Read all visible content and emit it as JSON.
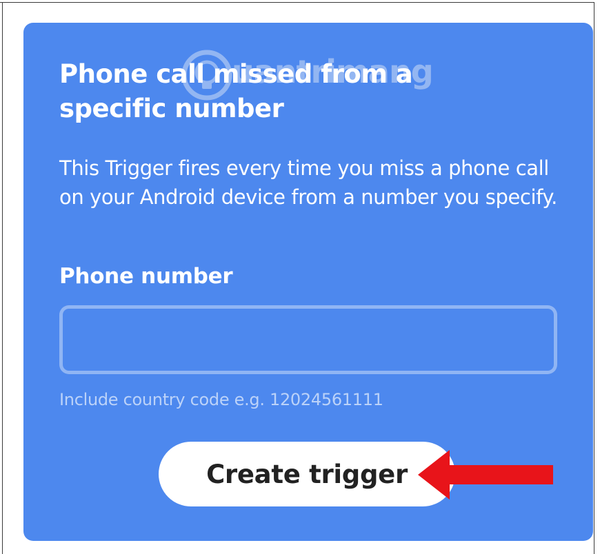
{
  "card": {
    "title": "Phone call missed from a specific number",
    "description": "This Trigger fires every time you miss a phone call on your Android device from a number you specify.",
    "field_label": "Phone number",
    "phone_input": {
      "value": "",
      "placeholder": ""
    },
    "hint": "Include country code e.g. 12024561111",
    "create_button_label": "Create trigger"
  },
  "watermark": {
    "text": "uantrimang"
  },
  "annotation": {
    "arrow_color": "#e8141a"
  },
  "colors": {
    "card_background": "#4d88ee",
    "button_background": "#ffffff",
    "button_text": "#222222"
  },
  "icons": {
    "watermark_logo": "lightbulb-icon",
    "annotation_arrow": "arrow-left-icon"
  }
}
